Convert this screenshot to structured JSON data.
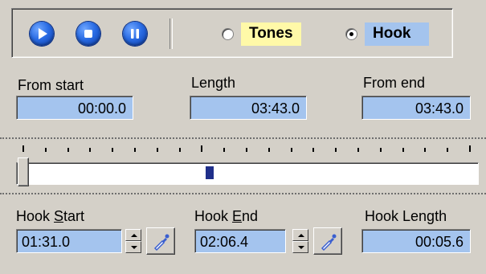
{
  "toolbar": {
    "buttons": [
      {
        "name": "play-icon",
        "label": ""
      },
      {
        "name": "stop-icon",
        "label": ""
      },
      {
        "name": "pause-icon",
        "label": ""
      }
    ],
    "mode_options": [
      {
        "label": "Tones",
        "selected": false,
        "highlight": "#fff9a8"
      },
      {
        "label": "Hook",
        "selected": true,
        "highlight": "#a4c4ee"
      }
    ]
  },
  "range": {
    "from_start_label": "From start",
    "from_start_value": "00:00.0",
    "length_label": "Length",
    "length_value": "03:43.0",
    "from_end_label": "From end",
    "from_end_value": "03:43.0"
  },
  "hook": {
    "start_label_pre": "Hook ",
    "start_label_key": "S",
    "start_label_post": "tart",
    "start_value": "01:31.0",
    "end_label_pre": "Hook ",
    "end_label_key": "E",
    "end_label_post": "nd",
    "end_value": "02:06.4",
    "length_label": "Hook Length",
    "length_value": "00:05.6"
  },
  "colors": {
    "field_bg": "#a4c4ee",
    "button_blue": "#2a6ce4",
    "marker": "#1f2f8a",
    "pick_icon": "#3a5fd0"
  },
  "slider": {
    "position_fraction": 0.0,
    "hook_marker_fraction": 0.41
  }
}
